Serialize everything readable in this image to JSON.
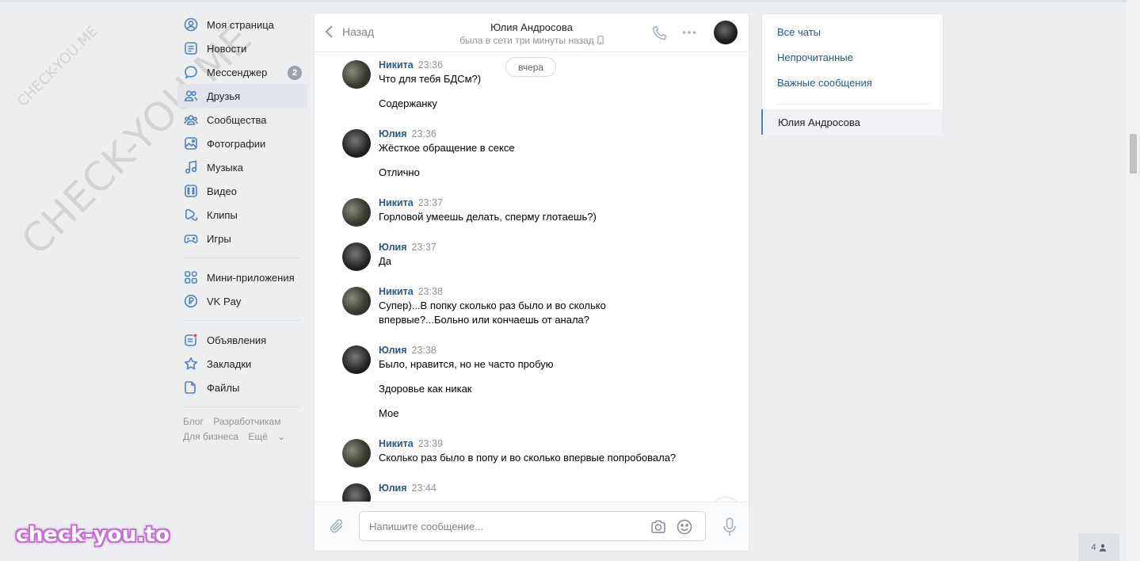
{
  "watermarks": {
    "small": "CHECK-YOU.ME",
    "large": "CHECK-YOU.ME",
    "brand": "check-you.to"
  },
  "left_nav": {
    "items": [
      {
        "label": "Моя страница",
        "icon": "user-circle-icon"
      },
      {
        "label": "Новости",
        "icon": "news-icon"
      },
      {
        "label": "Мессенджер",
        "icon": "message-icon",
        "badge": "2"
      },
      {
        "label": "Друзья",
        "icon": "friends-icon"
      },
      {
        "label": "Сообщества",
        "icon": "communities-icon"
      },
      {
        "label": "Фотографии",
        "icon": "photos-icon"
      },
      {
        "label": "Музыка",
        "icon": "music-icon"
      },
      {
        "label": "Видео",
        "icon": "video-icon"
      },
      {
        "label": "Клипы",
        "icon": "clips-icon"
      },
      {
        "label": "Игры",
        "icon": "games-icon"
      }
    ],
    "items2": [
      {
        "label": "Мини-приложения",
        "icon": "apps-icon"
      },
      {
        "label": "VK Pay",
        "icon": "vkpay-icon"
      }
    ],
    "items3": [
      {
        "label": "Объявления",
        "icon": "ads-icon"
      },
      {
        "label": "Закладки",
        "icon": "bookmark-star-icon"
      },
      {
        "label": "Файлы",
        "icon": "file-icon"
      }
    ],
    "footer": {
      "blog": "Блог",
      "developers": "Разработчикам",
      "business": "Для бизнеса",
      "more": "Ещё"
    }
  },
  "chat": {
    "back_label": "Назад",
    "peer_name": "Юлия Андросова",
    "peer_status": "была в сети три минуты назад",
    "date_pill": "вчера",
    "messages": [
      {
        "author": "Никита",
        "time": "23:36",
        "lines": [
          "Что для тебя БДСм?)",
          "Содержанку"
        ]
      },
      {
        "author": "Юлия",
        "time": "23:36",
        "lines": [
          "Жёсткое обращение в сексе",
          "Отлично"
        ]
      },
      {
        "author": "Никита",
        "time": "23:37",
        "lines": [
          "Горловой умеешь делать, сперму глотаешь?)"
        ]
      },
      {
        "author": "Юлия",
        "time": "23:37",
        "lines": [
          "Да"
        ]
      },
      {
        "author": "Никита",
        "time": "23:38",
        "lines": [
          "Супер)...В попку сколько раз было и во сколько",
          "впервые?...Больно или кончаешь от анала?"
        ]
      },
      {
        "author": "Юлия",
        "time": "23:38",
        "lines": [
          "Было, нравится, но не часто пробую",
          "Здоровье как никак",
          "Мое"
        ]
      },
      {
        "author": "Никита",
        "time": "23:39",
        "lines": [
          "Сколько раз было в попу и во сколько впервые попробовала?"
        ]
      },
      {
        "author": "Юлия",
        "time": "23:44",
        "lines": []
      }
    ],
    "composer_placeholder": "Напишите сообщение..."
  },
  "right_panel": {
    "all_chats": "Все чаты",
    "unread": "Непрочитанные",
    "important": "Важные сообщения",
    "active_chat": "Юлия Андросова"
  },
  "online_count": "4",
  "colors": {
    "accent": "#5181b8",
    "link": "#2a5885",
    "background": "#edeef0"
  }
}
